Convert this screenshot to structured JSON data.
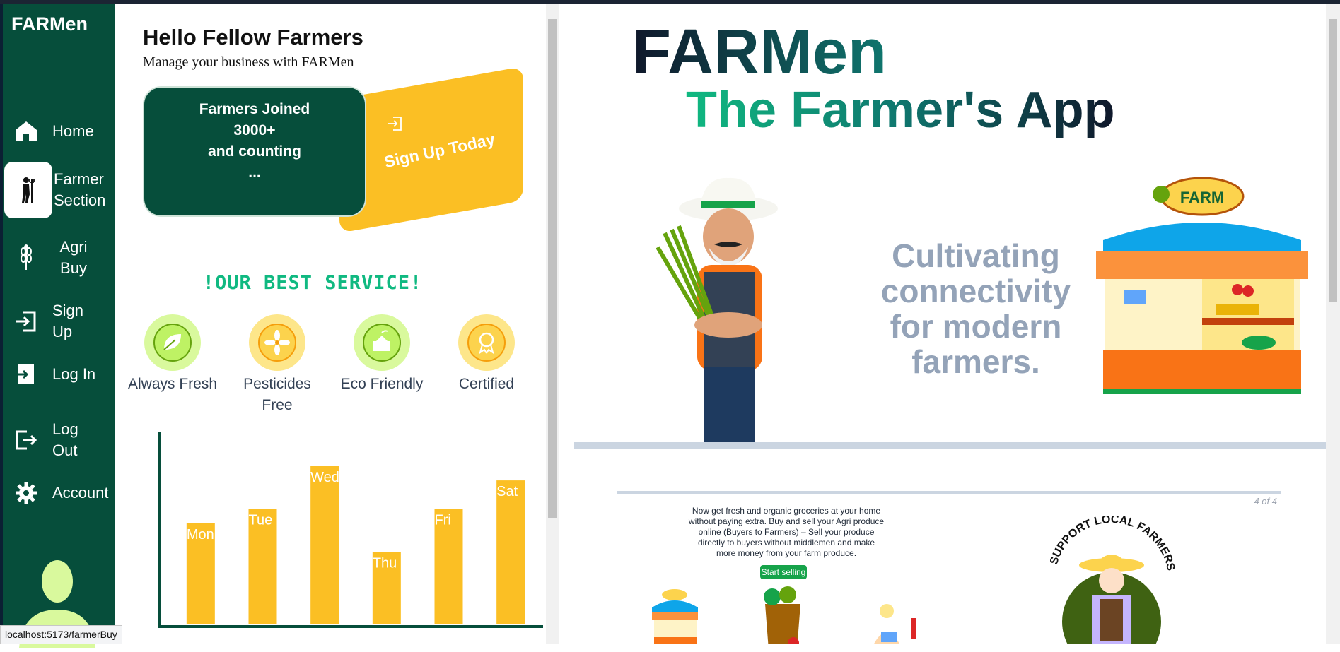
{
  "sidebar": {
    "brand": "FARMen",
    "items": [
      {
        "label": "Home",
        "icon": "home-icon"
      },
      {
        "label": "Farmer Section",
        "icon": "farmer-icon"
      },
      {
        "label": "Agri Buy",
        "icon": "wheat-icon"
      },
      {
        "label": "Sign Up",
        "icon": "sign-in-icon"
      },
      {
        "label": "Log In",
        "icon": "login-icon"
      },
      {
        "label": "Log Out",
        "icon": "logout-icon"
      },
      {
        "label": "Account",
        "icon": "gear-icon"
      }
    ]
  },
  "panel": {
    "greeting": "Hello Fellow Farmers",
    "subtitle": "Manage your business with FARMen",
    "joined": {
      "line1": "Farmers Joined",
      "line2": "3000+",
      "line3": "and counting",
      "line4": "..."
    },
    "signup_label": "Sign Up Today",
    "best_service": "!OUR BEST SERVICE!",
    "features": [
      {
        "label": "Always Fresh",
        "icon": "leaf-icon"
      },
      {
        "label": "Pesticides Free",
        "icon": "flower-icon"
      },
      {
        "label": "Eco Friendly",
        "icon": "eco-box-icon"
      },
      {
        "label": "Certified",
        "icon": "badge-icon"
      }
    ]
  },
  "chart_data": {
    "type": "bar",
    "categories": [
      "Mon",
      "Tue",
      "Wed",
      "Thu",
      "Fri",
      "Sat"
    ],
    "values": [
      70,
      80,
      110,
      50,
      80,
      100
    ],
    "ylim": [
      0,
      138
    ],
    "bar_color": "#fbbf24",
    "axis_color": "#064e3b"
  },
  "hero": {
    "title": "FARMen",
    "subtitle": "The Farmer's App",
    "tagline": "Cultivating connectivity for modern farmers.",
    "shop_sign": "FARM"
  },
  "slide": {
    "counter": "4 of 4",
    "description": "Now get fresh and organic groceries at your home without paying extra. Buy and sell your Agri produce online (Buyers to Farmers) – Sell your produce directly to buyers without middlemen and make more money from your farm produce.",
    "button": "Start selling",
    "badge_text": "SUPPORT LOCAL FARMERS"
  },
  "status_url": "localhost:5173/farmerBuy",
  "colors": {
    "sidebar": "#064e3b",
    "accent": "#fbbf24",
    "green": "#10b981"
  }
}
